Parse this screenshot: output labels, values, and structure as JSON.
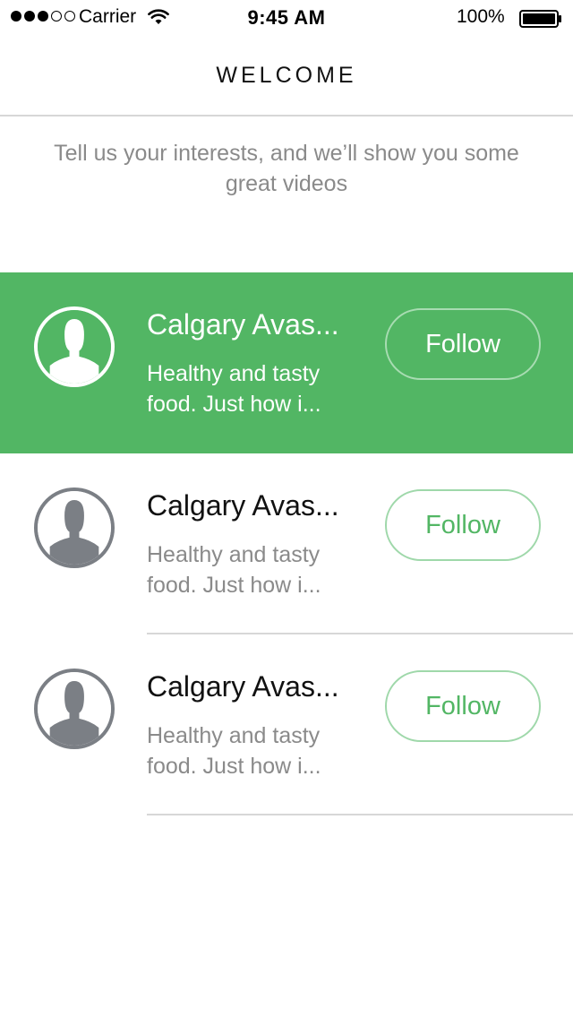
{
  "status_bar": {
    "carrier": "Carrier",
    "time": "9:45 AM",
    "battery": "100%",
    "signal_bars": 3,
    "signal_total": 5
  },
  "nav": {
    "title": "WELCOME"
  },
  "subtitle": "Tell us your interests, and we’ll show you some great videos",
  "colors": {
    "accent": "#52b664",
    "text_muted": "#8a8a8a",
    "divider": "#d7d7d7",
    "avatar_gray": "#7b7f85"
  },
  "channels": [
    {
      "title": "Calgary Avas...",
      "desc": "Healthy and tasty food. Just how i...",
      "button": "Follow",
      "highlighted": true
    },
    {
      "title": "Calgary Avas...",
      "desc": "Healthy and tasty food. Just how i...",
      "button": "Follow",
      "highlighted": false
    },
    {
      "title": "Calgary Avas...",
      "desc": "Healthy and tasty food. Just how i...",
      "button": "Follow",
      "highlighted": false
    }
  ]
}
